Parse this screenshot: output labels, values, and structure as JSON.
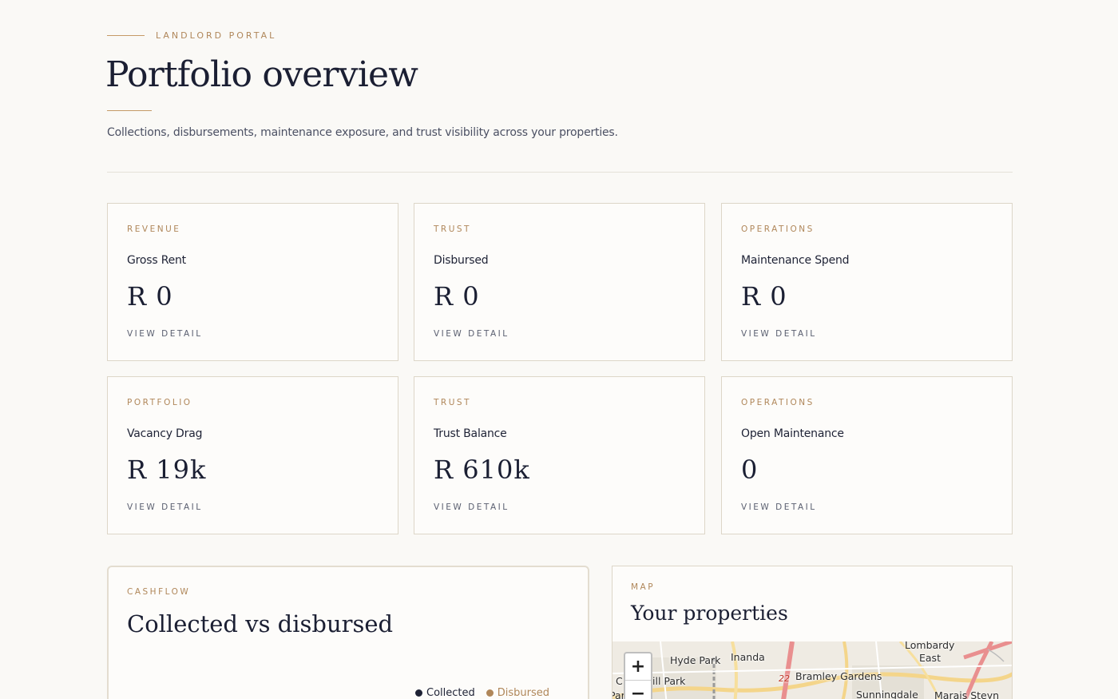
{
  "header": {
    "eyebrow": "LANDLORD PORTAL",
    "title": "Portfolio overview",
    "subtitle": "Collections, disbursements, maintenance exposure, and trust visibility across your properties."
  },
  "cards": [
    {
      "category": "REVENUE",
      "label": "Gross Rent",
      "value": "R 0",
      "link": "VIEW DETAIL"
    },
    {
      "category": "TRUST",
      "label": "Disbursed",
      "value": "R 0",
      "link": "VIEW DETAIL"
    },
    {
      "category": "OPERATIONS",
      "label": "Maintenance Spend",
      "value": "R 0",
      "link": "VIEW DETAIL"
    },
    {
      "category": "PORTFOLIO",
      "label": "Vacancy Drag",
      "value": "R 19k",
      "link": "VIEW DETAIL"
    },
    {
      "category": "TRUST",
      "label": "Trust Balance",
      "value": "R 610k",
      "link": "VIEW DETAIL"
    },
    {
      "category": "OPERATIONS",
      "label": "Open Maintenance",
      "value": "0",
      "link": "VIEW DETAIL"
    }
  ],
  "cashflow": {
    "category": "CASHFLOW",
    "title": "Collected vs disbursed",
    "legend": [
      {
        "name": "Collected",
        "color": "#1e2235"
      },
      {
        "name": "Disbursed",
        "color": "#b0875a"
      }
    ]
  },
  "map": {
    "category": "MAP",
    "title": "Your properties",
    "zoom_in": "+",
    "zoom_out": "−",
    "labels": {
      "hyde_park": "Hyde Park",
      "inanda": "Inanda",
      "lombardy": "Lombardy",
      "east": "East",
      "bramley": "Bramley Gardens",
      "road_num": "22",
      "ill_park": "ill Park",
      "c": "C",
      "sunningdale": "Sunningdale",
      "marais": "Marais Steyn",
      "par": "Par"
    }
  },
  "colors": {
    "accent": "#b0875a",
    "ink": "#1b1f33",
    "background": "#faf9f6"
  }
}
